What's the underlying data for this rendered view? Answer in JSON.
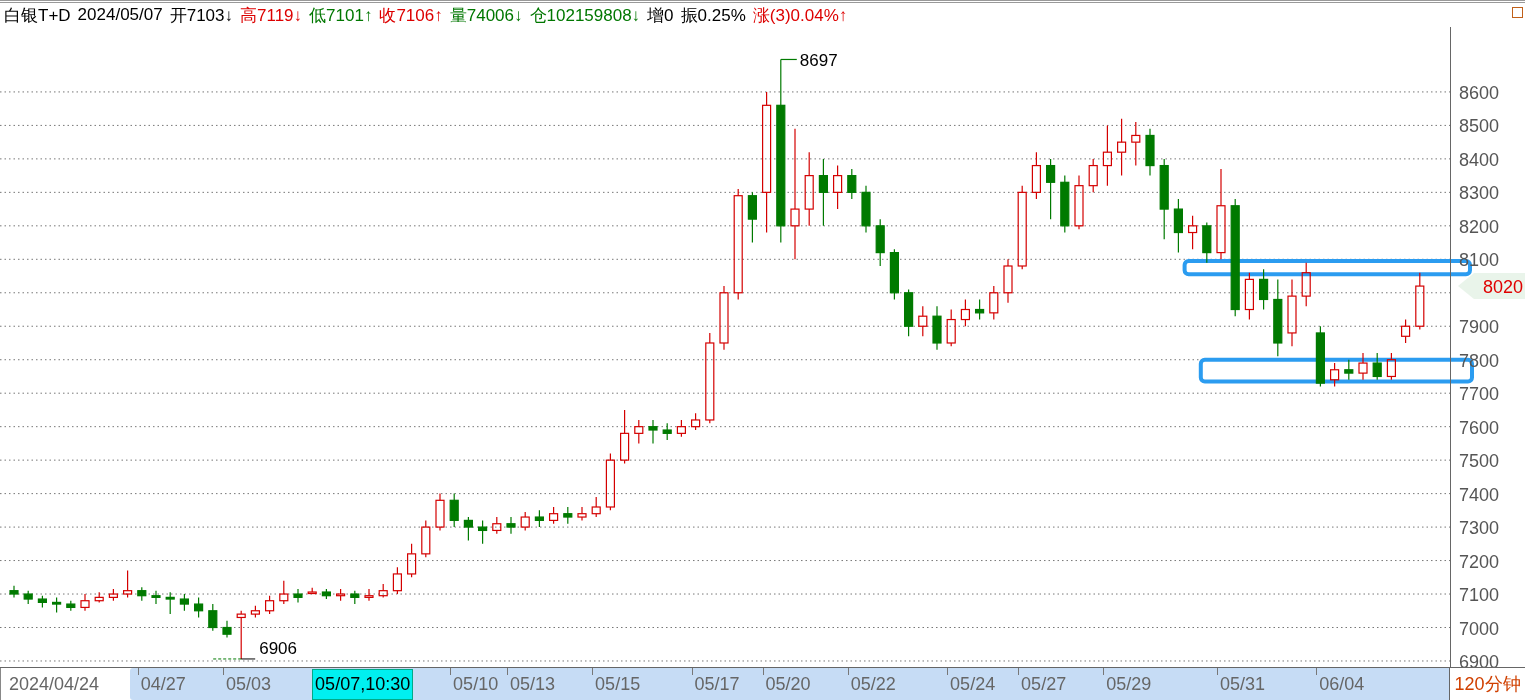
{
  "header": {
    "items": [
      {
        "text": "白银T+D",
        "color": "#000000"
      },
      {
        "text": "2024/05/07",
        "color": "#000000"
      },
      {
        "text": "开7103↓",
        "color": "#000000"
      },
      {
        "text": "高7119↓",
        "color": "#dd0000"
      },
      {
        "text": "低7101↑",
        "color": "#007700"
      },
      {
        "text": "收7106↑",
        "color": "#dd0000"
      },
      {
        "text": "量74006↓",
        "color": "#007700"
      },
      {
        "text": "仓102159808↓",
        "color": "#007700"
      },
      {
        "text": "增0",
        "color": "#000000"
      },
      {
        "text": "振0.25%",
        "color": "#000000"
      },
      {
        "text": "涨(3)0.04%↑",
        "color": "#dd0000"
      }
    ]
  },
  "chart": {
    "chart_data": {
      "type": "candlestick",
      "grid": true,
      "ylim": [
        6882,
        8794
      ],
      "yticks": [
        6900,
        7000,
        7100,
        7200,
        7300,
        7400,
        7500,
        7600,
        7700,
        7800,
        7900,
        8100,
        8200,
        8300,
        8400,
        8500,
        8600
      ],
      "ohlc": [
        [
          7110,
          7125,
          7090,
          7100
        ],
        [
          7100,
          7110,
          7070,
          7085
        ],
        [
          7085,
          7095,
          7060,
          7075
        ],
        [
          7075,
          7090,
          7045,
          7070
        ],
        [
          7070,
          7080,
          7050,
          7060
        ],
        [
          7060,
          7100,
          7050,
          7080
        ],
        [
          7080,
          7105,
          7075,
          7090
        ],
        [
          7090,
          7115,
          7080,
          7100
        ],
        [
          7100,
          7170,
          7090,
          7110
        ],
        [
          7110,
          7120,
          7080,
          7095
        ],
        [
          7095,
          7110,
          7070,
          7090
        ],
        [
          7090,
          7105,
          7040,
          7085
        ],
        [
          7085,
          7100,
          7050,
          7070
        ],
        [
          7070,
          7090,
          7030,
          7050
        ],
        [
          7050,
          7070,
          6990,
          7000
        ],
        [
          7000,
          7020,
          6970,
          6980
        ],
        [
          7030,
          7050,
          6906,
          7040
        ],
        [
          7040,
          7065,
          7030,
          7050
        ],
        [
          7050,
          7095,
          7040,
          7080
        ],
        [
          7080,
          7140,
          7070,
          7100
        ],
        [
          7100,
          7115,
          7075,
          7090
        ],
        [
          7103,
          7119,
          7101,
          7106
        ],
        [
          7106,
          7115,
          7085,
          7095
        ],
        [
          7095,
          7115,
          7080,
          7100
        ],
        [
          7100,
          7110,
          7070,
          7090
        ],
        [
          7090,
          7115,
          7080,
          7095
        ],
        [
          7095,
          7130,
          7090,
          7110
        ],
        [
          7110,
          7180,
          7100,
          7160
        ],
        [
          7160,
          7250,
          7150,
          7220
        ],
        [
          7220,
          7320,
          7210,
          7300
        ],
        [
          7300,
          7400,
          7290,
          7380
        ],
        [
          7380,
          7400,
          7300,
          7320
        ],
        [
          7320,
          7330,
          7260,
          7300
        ],
        [
          7300,
          7320,
          7250,
          7290
        ],
        [
          7290,
          7330,
          7280,
          7310
        ],
        [
          7310,
          7330,
          7280,
          7300
        ],
        [
          7300,
          7345,
          7290,
          7330
        ],
        [
          7330,
          7350,
          7300,
          7320
        ],
        [
          7320,
          7360,
          7310,
          7340
        ],
        [
          7340,
          7360,
          7310,
          7330
        ],
        [
          7330,
          7360,
          7320,
          7340
        ],
        [
          7340,
          7390,
          7330,
          7360
        ],
        [
          7360,
          7520,
          7350,
          7500
        ],
        [
          7500,
          7650,
          7490,
          7580
        ],
        [
          7580,
          7620,
          7550,
          7600
        ],
        [
          7600,
          7620,
          7550,
          7590
        ],
        [
          7590,
          7610,
          7560,
          7580
        ],
        [
          7580,
          7620,
          7570,
          7600
        ],
        [
          7600,
          7640,
          7590,
          7620
        ],
        [
          7620,
          7880,
          7610,
          7850
        ],
        [
          7850,
          8020,
          7830,
          8000
        ],
        [
          8000,
          8310,
          7980,
          8290
        ],
        [
          8290,
          8300,
          8150,
          8220
        ],
        [
          8300,
          8600,
          8180,
          8560
        ],
        [
          8560,
          8697,
          8150,
          8200
        ],
        [
          8200,
          8490,
          8100,
          8250
        ],
        [
          8250,
          8420,
          8200,
          8350
        ],
        [
          8350,
          8400,
          8200,
          8300
        ],
        [
          8300,
          8380,
          8250,
          8350
        ],
        [
          8350,
          8370,
          8280,
          8300
        ],
        [
          8300,
          8320,
          8180,
          8200
        ],
        [
          8200,
          8220,
          8080,
          8120
        ],
        [
          8120,
          8130,
          7980,
          8000
        ],
        [
          8000,
          8010,
          7870,
          7900
        ],
        [
          7900,
          7960,
          7870,
          7930
        ],
        [
          7930,
          7960,
          7830,
          7850
        ],
        [
          7850,
          7950,
          7840,
          7920
        ],
        [
          7920,
          7980,
          7900,
          7950
        ],
        [
          7950,
          7980,
          7920,
          7940
        ],
        [
          7940,
          8020,
          7920,
          8000
        ],
        [
          8000,
          8100,
          7970,
          8080
        ],
        [
          8080,
          8320,
          8070,
          8300
        ],
        [
          8300,
          8420,
          8280,
          8380
        ],
        [
          8380,
          8400,
          8220,
          8330
        ],
        [
          8330,
          8350,
          8180,
          8200
        ],
        [
          8200,
          8350,
          8190,
          8320
        ],
        [
          8320,
          8400,
          8300,
          8380
        ],
        [
          8380,
          8500,
          8320,
          8420
        ],
        [
          8420,
          8520,
          8350,
          8450
        ],
        [
          8450,
          8510,
          8380,
          8470
        ],
        [
          8470,
          8490,
          8350,
          8380
        ],
        [
          8380,
          8400,
          8160,
          8250
        ],
        [
          8250,
          8280,
          8120,
          8180
        ],
        [
          8180,
          8230,
          8130,
          8200
        ],
        [
          8200,
          8210,
          8090,
          8120
        ],
        [
          8120,
          8370,
          8100,
          8260
        ],
        [
          8260,
          8280,
          7930,
          7950
        ],
        [
          7950,
          8060,
          7920,
          8040
        ],
        [
          8040,
          8070,
          7950,
          7980
        ],
        [
          7980,
          8040,
          7810,
          7850
        ],
        [
          7880,
          8040,
          7840,
          7990
        ],
        [
          7990,
          8090,
          7960,
          8060
        ],
        [
          7880,
          7900,
          7720,
          7730
        ],
        [
          7740,
          7790,
          7720,
          7770
        ],
        [
          7770,
          7800,
          7740,
          7760
        ],
        [
          7760,
          7820,
          7740,
          7790
        ],
        [
          7790,
          7820,
          7740,
          7750
        ],
        [
          7750,
          7820,
          7740,
          7800
        ],
        [
          7870,
          7920,
          7850,
          7900
        ],
        [
          7900,
          8060,
          7890,
          8020
        ]
      ],
      "annotations": [
        "8697",
        "6906"
      ]
    },
    "date_axis": {
      "labels": [
        "2024/04/24",
        "04/27",
        "05/03",
        "05/10",
        "05/13",
        "05/15",
        "05/17",
        "05/20",
        "05/22",
        "05/24",
        "05/27",
        "05/29",
        "05/31",
        "06/04"
      ]
    },
    "cursor": {
      "label": "05/07,10:30"
    },
    "last_price": {
      "label": "8020"
    },
    "period": "120分钟"
  }
}
